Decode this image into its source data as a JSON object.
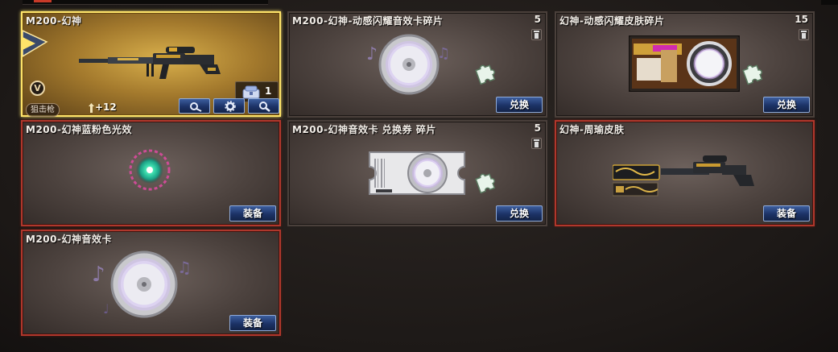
{
  "items": [
    {
      "title": "M200-幻神",
      "count": "1",
      "category_tag": "狙击枪",
      "upgrade": "+12",
      "badge": "V"
    },
    {
      "title": "M200-幻神-动感闪耀音效卡碎片",
      "count": "5",
      "action_label": "兑换"
    },
    {
      "title": "幻神-动感闪耀皮肤碎片",
      "count": "15",
      "action_label": "兑换"
    },
    {
      "title": "M200-幻神蓝粉色光效",
      "action_label": "装备"
    },
    {
      "title": "M200-幻神音效卡 兑换券 碎片",
      "count": "5",
      "action_label": "兑换"
    },
    {
      "title": "幻神-周瑜皮肤",
      "action_label": "装备"
    },
    {
      "title": "M200-幻神音效卡",
      "action_label": "装备"
    }
  ],
  "icons": {
    "wrench_gear": "wrench-gear-icon",
    "settings": "gear-icon",
    "search": "magnifier-icon",
    "trash": "trash-icon",
    "puzzle": "puzzle-piece-icon",
    "box": "item-box-icon"
  },
  "colors": {
    "equipped_border": "#b0372c",
    "selected_border": "#ffe46a",
    "button_blue": "#1c3266"
  }
}
